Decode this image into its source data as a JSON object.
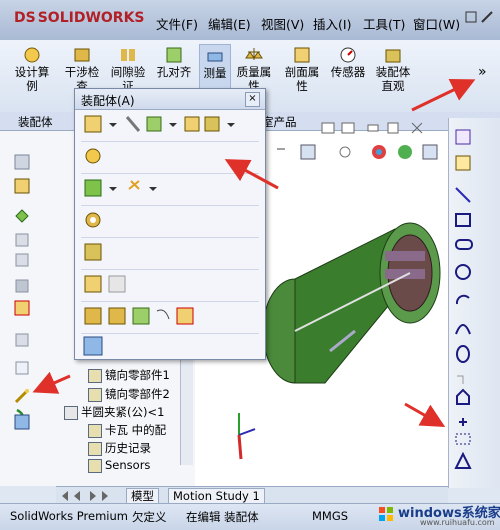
{
  "app": {
    "logo_text": "SOLIDWORKS",
    "logo_prefix": "DS"
  },
  "menu": {
    "items": [
      "文件(F)",
      "编辑(E)",
      "视图(V)",
      "插入(I)",
      "工具(T)",
      "窗口(W)"
    ]
  },
  "ribbon": {
    "buttons": [
      "设计算例",
      "干涉检查",
      "间隙验证",
      "孔对齐",
      "测量",
      "质量属性",
      "剖面属性",
      "传感器",
      "装配体直观"
    ],
    "more": "»"
  },
  "tabs": {
    "assembly": "装配体",
    "product": "室产品"
  },
  "popup": {
    "title": "装配体(A)",
    "close": "×"
  },
  "tree": {
    "items": [
      "镜向零部件1",
      "镜向零部件2",
      "半圆夹紧(公)<1",
      "卡瓦 中的配",
      "历史记录",
      "Sensors"
    ]
  },
  "bottom_tabs": {
    "model": "模型",
    "motion": "Motion Study 1"
  },
  "status": {
    "app": "SolidWorks Premium",
    "state": "欠定义",
    "editing": "在编辑 装配体",
    "units": "MMGS"
  },
  "watermark": {
    "text": "windows系统家园",
    "url": "www.ruihuafu.com"
  },
  "colors": {
    "arrow": "#e0302a",
    "brand": "#b21f24",
    "model": "#3a7d2c"
  }
}
